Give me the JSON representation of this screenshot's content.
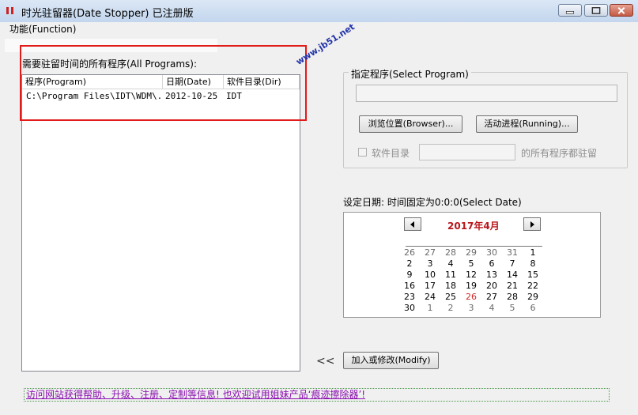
{
  "window": {
    "title": "时光驻留器(Date Stopper) 已注册版"
  },
  "menu": {
    "function_label": "功能(Function)"
  },
  "programs": {
    "label": "需要驻留时间的所有程序(All Programs):",
    "columns": [
      "程序(Program)",
      "日期(Date)",
      "软件目录(Dir)"
    ],
    "rows": [
      {
        "program": "C:\\Program Files\\IDT\\WDM\\...",
        "date": "2012-10-25",
        "dir": "IDT"
      }
    ]
  },
  "watermark": "www.jb51.net",
  "select_program": {
    "legend": "指定程序(Select Program)",
    "program_value": "",
    "browse_label": "浏览位置(Browser)...",
    "running_label": "活动进程(Running)...",
    "dir_checkbox_label": "软件目录",
    "dir_value": "",
    "dir_suffix": "的所有程序都驻留"
  },
  "date": {
    "label": "设定日期: 时间固定为0:0:0(Select Date)"
  },
  "calendar": {
    "title": "2017年4月",
    "weeks": [
      [
        {
          "d": "26",
          "t": "prev"
        },
        {
          "d": "27",
          "t": "prev"
        },
        {
          "d": "28",
          "t": "prev"
        },
        {
          "d": "29",
          "t": "prev"
        },
        {
          "d": "30",
          "t": "prev"
        },
        {
          "d": "31",
          "t": "prev"
        },
        {
          "d": "1",
          "t": "cur"
        }
      ],
      [
        {
          "d": "2",
          "t": "cur"
        },
        {
          "d": "3",
          "t": "cur"
        },
        {
          "d": "4",
          "t": "cur"
        },
        {
          "d": "5",
          "t": "cur"
        },
        {
          "d": "6",
          "t": "cur"
        },
        {
          "d": "7",
          "t": "cur"
        },
        {
          "d": "8",
          "t": "cur"
        }
      ],
      [
        {
          "d": "9",
          "t": "cur"
        },
        {
          "d": "10",
          "t": "cur"
        },
        {
          "d": "11",
          "t": "cur"
        },
        {
          "d": "12",
          "t": "cur"
        },
        {
          "d": "13",
          "t": "cur"
        },
        {
          "d": "14",
          "t": "cur"
        },
        {
          "d": "15",
          "t": "cur"
        }
      ],
      [
        {
          "d": "16",
          "t": "cur"
        },
        {
          "d": "17",
          "t": "cur"
        },
        {
          "d": "18",
          "t": "cur"
        },
        {
          "d": "19",
          "t": "cur"
        },
        {
          "d": "20",
          "t": "cur"
        },
        {
          "d": "21",
          "t": "cur"
        },
        {
          "d": "22",
          "t": "cur"
        }
      ],
      [
        {
          "d": "23",
          "t": "cur"
        },
        {
          "d": "24",
          "t": "cur"
        },
        {
          "d": "25",
          "t": "cur"
        },
        {
          "d": "26",
          "t": "today"
        },
        {
          "d": "27",
          "t": "cur"
        },
        {
          "d": "28",
          "t": "cur"
        },
        {
          "d": "29",
          "t": "cur"
        }
      ],
      [
        {
          "d": "30",
          "t": "cur"
        },
        {
          "d": "1",
          "t": "next"
        },
        {
          "d": "2",
          "t": "next"
        },
        {
          "d": "3",
          "t": "next"
        },
        {
          "d": "4",
          "t": "next"
        },
        {
          "d": "5",
          "t": "next"
        },
        {
          "d": "6",
          "t": "next"
        }
      ]
    ]
  },
  "actions": {
    "back_arrow": "<<",
    "modify_label": "加入或修改(Modify)"
  },
  "footer": {
    "link_text": "访问网站获得帮助、升级、注册、定制等信息! 也欢迎试用姐妹产品‘痕迹擦除器’!"
  }
}
